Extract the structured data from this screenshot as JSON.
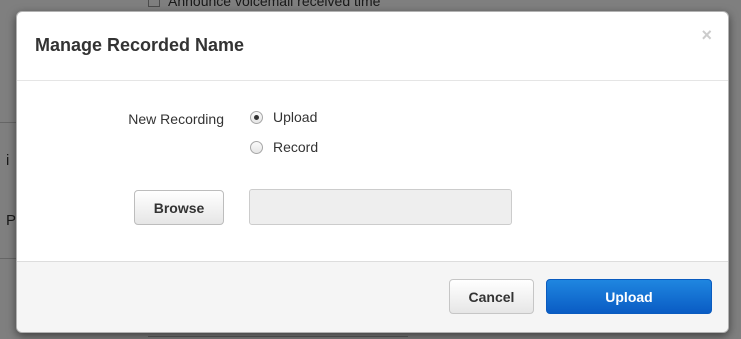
{
  "background": {
    "checkbox_label": "Announce voicemail received time",
    "partial_letter_1": "i",
    "partial_letter_2": "P"
  },
  "modal": {
    "title": "Manage Recorded Name",
    "close_glyph": "×",
    "new_recording_label": "New Recording",
    "options": [
      {
        "label": "Upload",
        "selected": true
      },
      {
        "label": "Record",
        "selected": false
      }
    ],
    "browse_label": "Browse",
    "file_value": "",
    "cancel_label": "Cancel",
    "upload_label": "Upload"
  },
  "colors": {
    "primary": "#0a6fd6",
    "overlay": "rgba(0,0,0,0.5)",
    "footer_bg": "#f5f5f5"
  },
  "icons": {
    "close": "close-icon",
    "radio_selected": "radio-checked-icon",
    "radio_unselected": "radio-unchecked-icon"
  }
}
